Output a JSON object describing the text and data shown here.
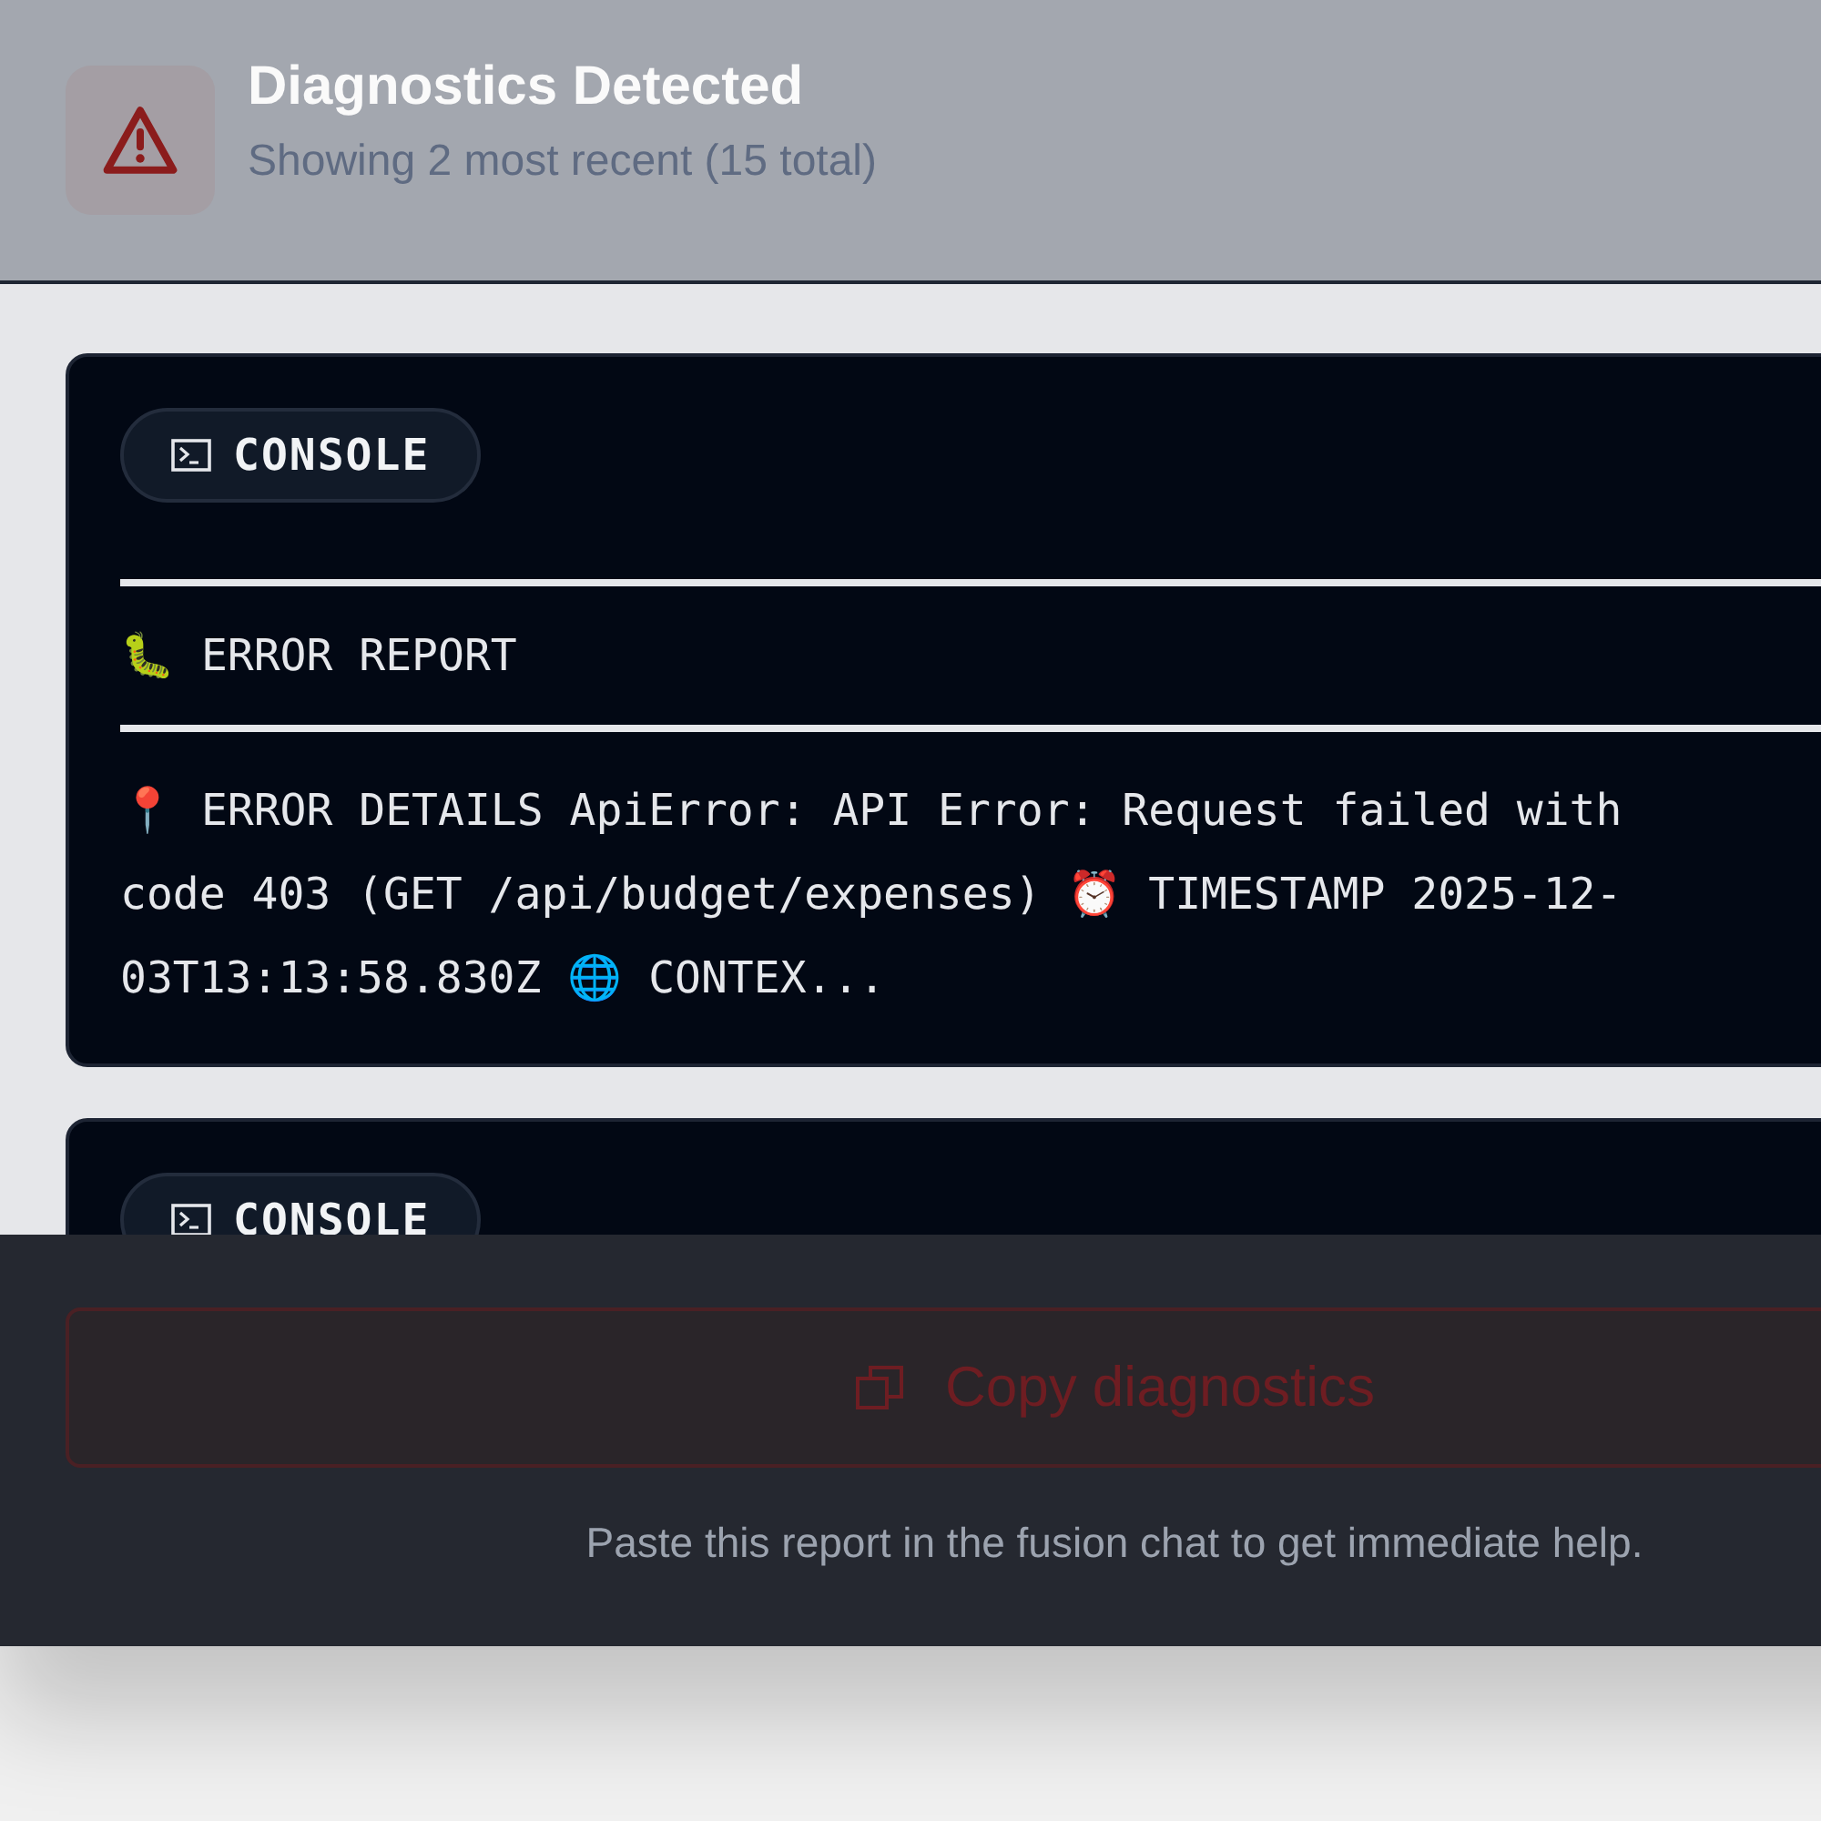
{
  "header": {
    "title": "Diagnostics Detected",
    "subtitle": "Showing 2 most recent (15 total)"
  },
  "entries": [
    {
      "badge": "CONSOLE",
      "heading": "🐛 ERROR REPORT",
      "details_lines": [
        "📍 ERROR DETAILS ApiError: API Error: Request failed with",
        "code 403 (GET /api/budget/expenses) ⏰ TIMESTAMP 2025-12-",
        "03T13:13:58.830Z 🌐 CONTEX..."
      ]
    },
    {
      "badge": "CONSOLE"
    }
  ],
  "footer": {
    "button": "Copy diagnostics",
    "hint": "Paste this report in the fusion chat to get immediate help."
  }
}
